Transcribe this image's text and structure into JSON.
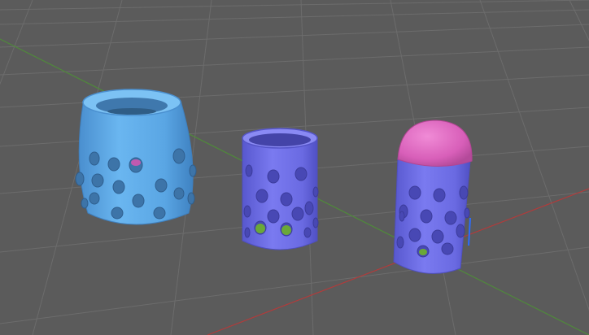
{
  "viewport": {
    "background": "#5b5b5b",
    "grid_color": "#6b6b6b",
    "x_axis_color": "#b23b3b",
    "y_axis_color": "#4f8a3a",
    "gizmo_color": "#2b6cff"
  },
  "objects": [
    {
      "name": "vase",
      "color": "#5ea8e6",
      "holes": 14
    },
    {
      "name": "cylinder",
      "color": "#6f6fe8",
      "holes": 18
    },
    {
      "name": "capsule",
      "body_color": "#6f6fe8",
      "cap_color": "#e06cc4",
      "holes": 20
    }
  ]
}
